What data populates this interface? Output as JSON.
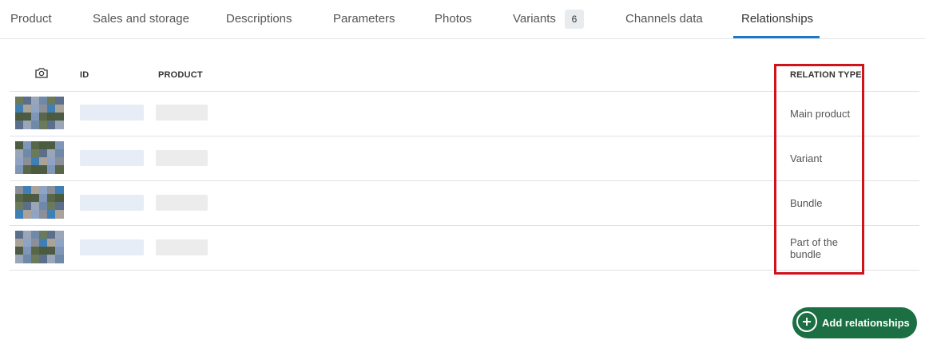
{
  "tabs": [
    {
      "label": "Product"
    },
    {
      "label": "Sales and storage"
    },
    {
      "label": "Descriptions"
    },
    {
      "label": "Parameters"
    },
    {
      "label": "Photos"
    },
    {
      "label": "Variants",
      "badge": "6"
    },
    {
      "label": "Channels data"
    },
    {
      "label": "Relationships",
      "active": true
    }
  ],
  "table": {
    "columns": {
      "photo_icon": "camera-icon",
      "id": "ID",
      "product": "PRODUCT",
      "relation_type": "RELATION TYPE"
    },
    "rows": [
      {
        "relation_type": "Main product"
      },
      {
        "relation_type": "Variant"
      },
      {
        "relation_type": "Bundle"
      },
      {
        "relation_type": "Part of the bundle"
      }
    ]
  },
  "actions": {
    "add_label": "Add relationships",
    "add_icon": "plus-circle-icon"
  },
  "colors": {
    "accent": "#1a77c9",
    "button": "#1b6f43",
    "highlight": "#d0121b"
  }
}
